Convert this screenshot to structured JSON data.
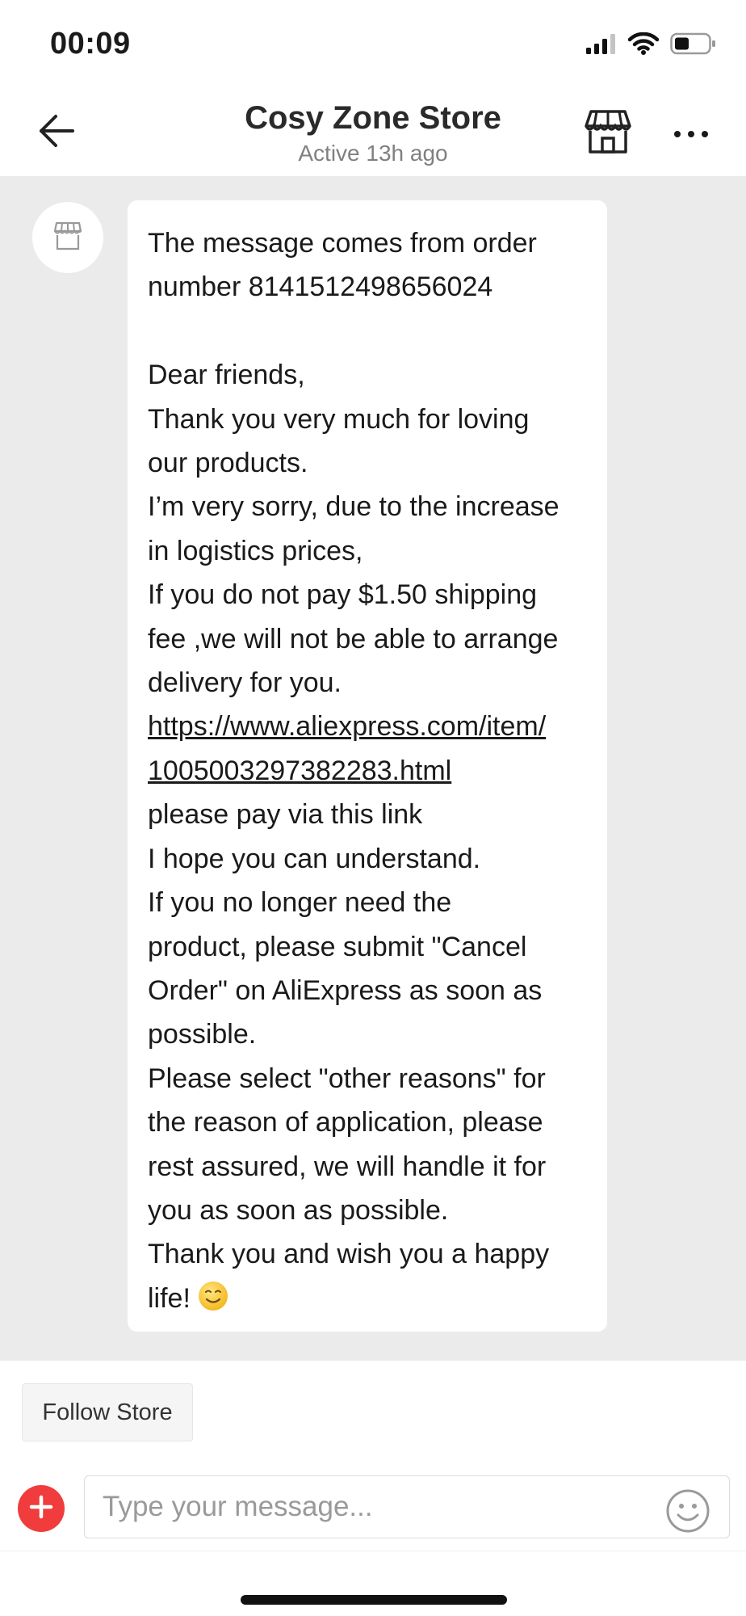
{
  "status_bar": {
    "time": "00:09",
    "icons": [
      "signal-icon",
      "wifi-icon",
      "battery-icon"
    ]
  },
  "header": {
    "store_name": "Cosy Zone Store",
    "status": "Active 13h ago",
    "icons": {
      "back": "back-arrow-icon",
      "store": "store-icon",
      "more": "more-icon"
    }
  },
  "message": {
    "sender_icon": "store-icon",
    "lines": [
      "The message comes from order",
      "number 8141512498656024",
      "",
      "Dear friends,",
      "Thank you very much for loving",
      "our products.",
      "I’m very sorry, due to the increase",
      "in logistics prices,",
      "If you do not pay $1.50 shipping",
      "fee ,we will not be able to arrange",
      "delivery for you.",
      "https://www.aliexpress.com/item/",
      "1005003297382283.html",
      "please pay via this link",
      "I hope you can understand.",
      "If you no longer need the",
      "product, please submit \"Cancel",
      "Order\" on AliExpress as soon as",
      "possible.",
      "Please select \"other reasons\" for",
      "the reason of application, please",
      "rest assured, we will handle it for",
      "you as soon as possible.",
      "Thank you and wish you a happy",
      "life!"
    ],
    "emoji": "smiley-emoji-icon"
  },
  "footer": {
    "follow_label": "Follow Store",
    "input_placeholder": "Type your message...",
    "input_value": "",
    "icons": {
      "add": "plus-icon",
      "emoji": "smiley-icon"
    }
  },
  "colors": {
    "chat_background": "#ebebeb",
    "bubble": "#ffffff",
    "accent_red": "#f03c3c",
    "text": "#1a1a1a",
    "muted": "#808080"
  }
}
